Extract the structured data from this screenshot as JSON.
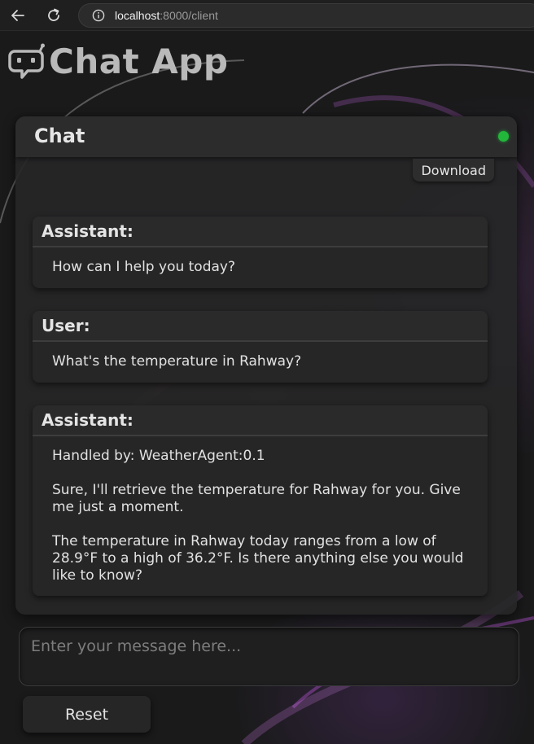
{
  "browser": {
    "url_host": "localhost",
    "url_path": ":8000/client",
    "icons": [
      "back-arrow-icon",
      "reload-icon",
      "info-icon"
    ]
  },
  "app": {
    "title": "Chat App",
    "logo_icon": "robot-chat-icon"
  },
  "chat": {
    "title": "Chat",
    "status": "connected",
    "status_color": "#22b63a",
    "download_label": "Download",
    "messages": [
      {
        "role": "Assistant:",
        "paragraphs": [
          "How can I help you today?"
        ]
      },
      {
        "role": "User:",
        "paragraphs": [
          "What's the temperature in Rahway?"
        ]
      },
      {
        "role": "Assistant:",
        "paragraphs": [
          "Handled by: WeatherAgent:0.1",
          "Sure, I'll retrieve the temperature for Rahway for you. Give me just a moment.",
          "The temperature in Rahway today ranges from a low of 28.9°F to a high of 36.2°F. Is there anything else you would like to know?"
        ]
      }
    ]
  },
  "composer": {
    "value": "",
    "placeholder": "Enter your message here...",
    "reset_label": "Reset"
  }
}
